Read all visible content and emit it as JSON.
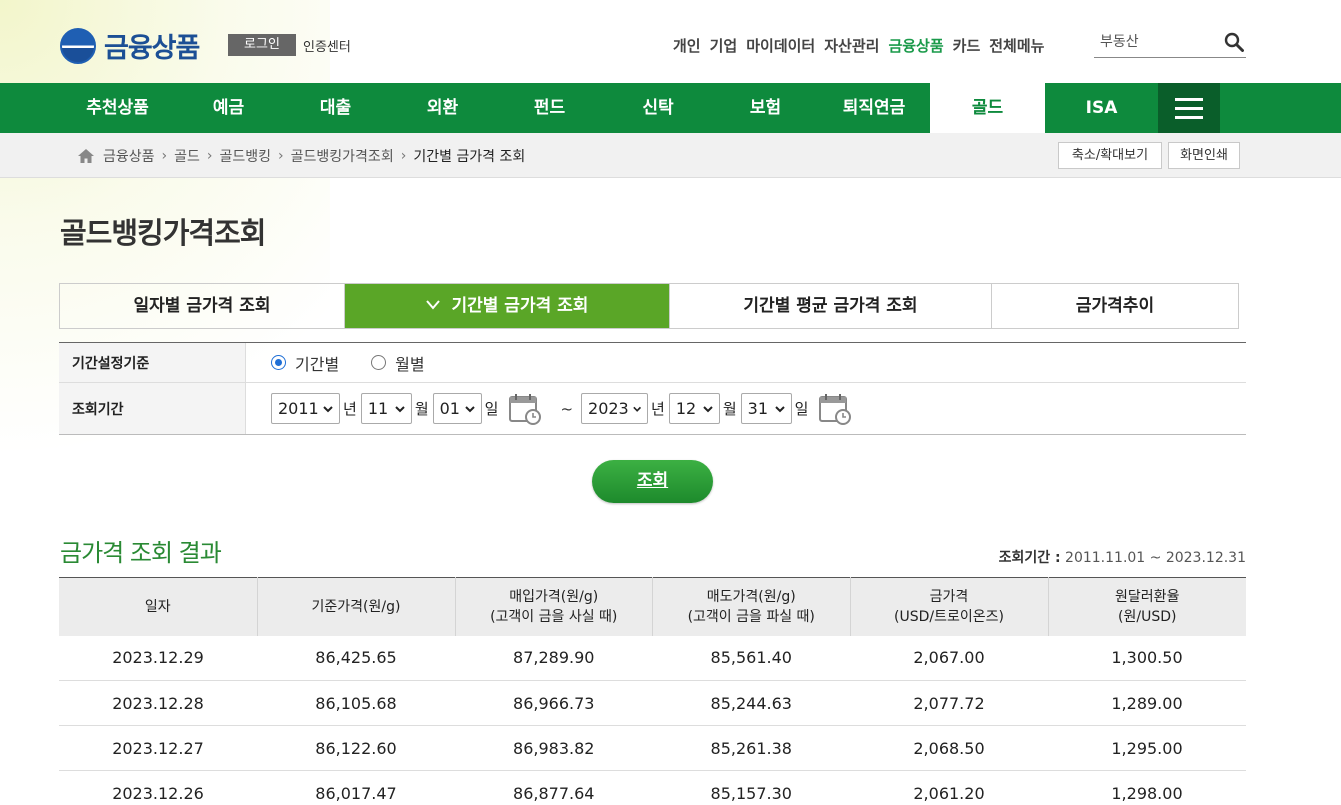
{
  "header": {
    "logo": "금융상품",
    "login": "로그인",
    "cert_center": "인증센터",
    "util_menu": [
      "개인",
      "기업",
      "마이데이터",
      "자산관리",
      "금융상품",
      "카드",
      "전체메뉴"
    ],
    "search_value": "부동산"
  },
  "gnb": [
    "추천상품",
    "예금",
    "대출",
    "외환",
    "펀드",
    "신탁",
    "보험",
    "퇴직연금",
    "골드",
    "ISA"
  ],
  "breadcrumb": [
    "금융상품",
    "골드",
    "골드뱅킹",
    "골드뱅킹가격조회",
    "기간별 금가격 조회"
  ],
  "crumb_buttons": {
    "zoom": "축소/확대보기",
    "print": "화면인쇄"
  },
  "page_title": "골드뱅킹가격조회",
  "tabs": [
    "일자별 금가격 조회",
    "기간별 금가격 조회",
    "기간별 평균 금가격 조회",
    "금가격추이"
  ],
  "form": {
    "basis_label": "기간설정기준",
    "radio_period": "기간별",
    "radio_month": "월별",
    "range_label": "조회기간",
    "from": {
      "year": "2011",
      "month": "11",
      "day": "01"
    },
    "to": {
      "year": "2023",
      "month": "12",
      "day": "31"
    },
    "unit_year": "년",
    "unit_month": "월",
    "unit_day": "일",
    "tilde": "~"
  },
  "query_button": "조회",
  "result": {
    "title": "금가격 조회 결과",
    "period_label": "조회기간 :",
    "period_value": "2011.11.01 ~ 2023.12.31",
    "headers": [
      [
        "일자",
        ""
      ],
      [
        "기준가격(원/g)",
        ""
      ],
      [
        "매입가격(원/g)",
        "(고객이 금을 사실 때)"
      ],
      [
        "매도가격(원/g)",
        "(고객이 금을 파실 때)"
      ],
      [
        "금가격",
        "(USD/트로이온즈)"
      ],
      [
        "원달러환율",
        "(원/USD)"
      ]
    ],
    "rows": [
      [
        "2023.12.29",
        "86,425.65",
        "87,289.90",
        "85,561.40",
        "2,067.00",
        "1,300.50"
      ],
      [
        "2023.12.28",
        "86,105.68",
        "86,966.73",
        "85,244.63",
        "2,077.72",
        "1,289.00"
      ],
      [
        "2023.12.27",
        "86,122.60",
        "86,983.82",
        "85,261.38",
        "2,068.50",
        "1,295.00"
      ],
      [
        "2023.12.26",
        "86,017.47",
        "86,877.64",
        "85,157.30",
        "2,061.20",
        "1,298.00"
      ]
    ]
  },
  "colors": {
    "brand_green": "#0e8a3d",
    "tab_green": "#5aa627",
    "result_green": "#2a8a34",
    "logo_blue": "#1c4f95"
  }
}
